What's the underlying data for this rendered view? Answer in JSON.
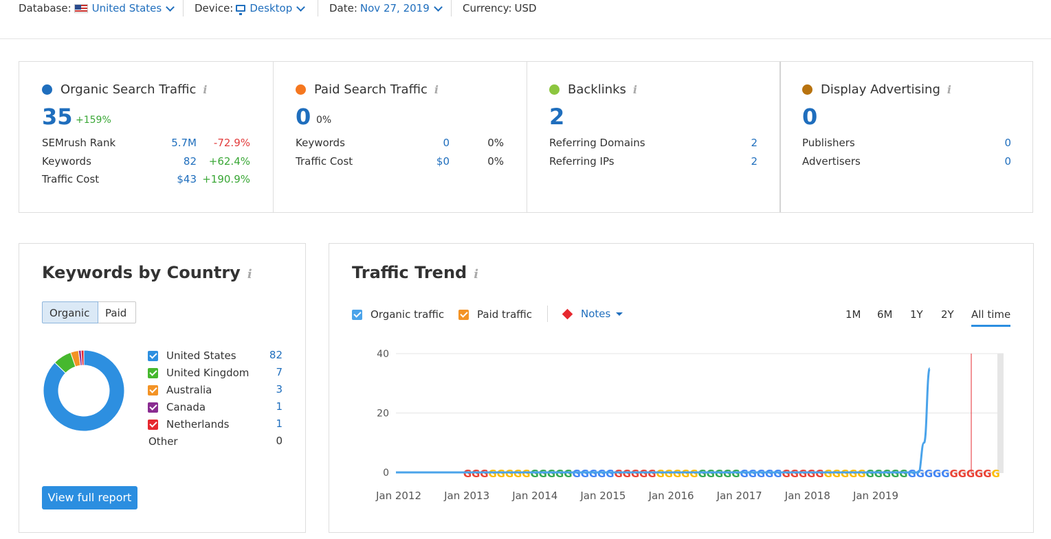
{
  "topbar": {
    "database_label": "Database:",
    "database_value": "United States",
    "device_label": "Device:",
    "device_value": "Desktop",
    "date_label": "Date:",
    "date_value": "Nov 27, 2019",
    "currency_label": "Currency:",
    "currency_value": "USD"
  },
  "metrics": {
    "organic": {
      "title": "Organic Search Traffic",
      "color": "#1f6ebd",
      "value": "35",
      "change": "+159%",
      "rows": [
        {
          "label": "SEMrush Rank",
          "value": "5.7M",
          "change": "-72.9%"
        },
        {
          "label": "Keywords",
          "value": "82",
          "change": "+62.4%"
        },
        {
          "label": "Traffic Cost",
          "value": "$43",
          "change": "+190.9%"
        }
      ]
    },
    "paid": {
      "title": "Paid Search Traffic",
      "color": "#f5771f",
      "value": "0",
      "change": "0%",
      "rows": [
        {
          "label": "Keywords",
          "value": "0",
          "change": "0%"
        },
        {
          "label": "Traffic Cost",
          "value": "$0",
          "change": "0%"
        }
      ]
    },
    "backlinks": {
      "title": "Backlinks",
      "color": "#8cc63f",
      "value": "2",
      "rows": [
        {
          "label": "Referring Domains",
          "value": "2"
        },
        {
          "label": "Referring IPs",
          "value": "2"
        }
      ]
    },
    "display": {
      "title": "Display Advertising",
      "color": "#b8730f",
      "value": "0",
      "rows": [
        {
          "label": "Publishers",
          "value": "0"
        },
        {
          "label": "Advertisers",
          "value": "0"
        }
      ]
    }
  },
  "keywords_by_country": {
    "title": "Keywords by Country",
    "tabs": [
      "Organic",
      "Paid"
    ],
    "active_tab": "Organic",
    "countries": [
      {
        "name": "United States",
        "value": "82",
        "color": "#2d8fe0"
      },
      {
        "name": "United Kingdom",
        "value": "7",
        "color": "#46b82e"
      },
      {
        "name": "Australia",
        "value": "3",
        "color": "#f39325"
      },
      {
        "name": "Canada",
        "value": "1",
        "color": "#8a2c91"
      },
      {
        "name": "Netherlands",
        "value": "1",
        "color": "#e6282f"
      }
    ],
    "other_label": "Other",
    "other_value": "0",
    "button": "View full report"
  },
  "traffic_trend": {
    "title": "Traffic Trend",
    "organic_label": "Organic traffic",
    "paid_label": "Paid traffic",
    "notes_label": "Notes",
    "ranges": [
      "1M",
      "6M",
      "1Y",
      "2Y",
      "All time"
    ],
    "active_range": "All time"
  },
  "chart_data": {
    "type": "line",
    "title": "Traffic Trend",
    "xlabel": "",
    "ylabel": "",
    "x_ticks": [
      "Jan 2012",
      "Jan 2013",
      "Jan 2014",
      "Jan 2015",
      "Jan 2016",
      "Jan 2017",
      "Jan 2018",
      "Jan 2019"
    ],
    "y_ticks": [
      0,
      20,
      40
    ],
    "ylim": [
      0,
      40
    ],
    "series": [
      {
        "name": "Organic traffic",
        "color": "#4aa3ea",
        "x": [
          "2012-01",
          "2019-09",
          "2019-10",
          "2019-11"
        ],
        "values": [
          0,
          0,
          10,
          35
        ]
      }
    ],
    "grid": true
  }
}
